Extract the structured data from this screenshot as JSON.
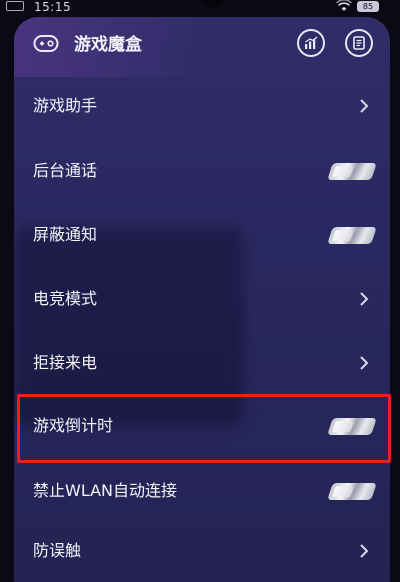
{
  "status_bar": {
    "time": "15:15",
    "battery": "85",
    "icons": [
      "game-mode-icon",
      "wifi-icon",
      "battery-icon"
    ]
  },
  "header": {
    "title": "游戏魔盒",
    "icons": [
      "gamepad-icon",
      "stats-icon",
      "notes-icon"
    ]
  },
  "settings": [
    {
      "label": "游戏助手",
      "control": "chevron"
    },
    {
      "label": "后台通话",
      "control": "toggle"
    },
    {
      "label": "屏蔽通知",
      "control": "toggle"
    },
    {
      "label": "电竞模式",
      "control": "chevron"
    },
    {
      "label": "拒接来电",
      "control": "chevron"
    },
    {
      "label": "游戏倒计时",
      "control": "toggle",
      "highlighted": true
    },
    {
      "label": "禁止WLAN自动连接",
      "control": "toggle"
    },
    {
      "label": "防误触",
      "control": "chevron"
    }
  ],
  "colors": {
    "panel": "#2b2962",
    "text": "#f4f3fb",
    "highlight": "#f01d1d",
    "toggle": "#d9d9e2"
  }
}
